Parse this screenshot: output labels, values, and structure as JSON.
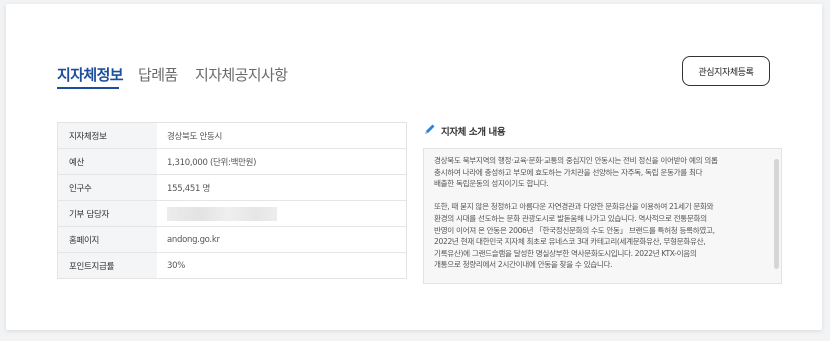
{
  "tabs": [
    {
      "label": "지자체정보",
      "active": true
    },
    {
      "label": "답례품",
      "active": false
    },
    {
      "label": "지자체공지사항",
      "active": false
    }
  ],
  "favorite_button": "관심지자체등록",
  "info_table": [
    {
      "label": "지자체정보",
      "value": "경상북도 안동시"
    },
    {
      "label": "예산",
      "value": "1,310,000 (단위:백만원)"
    },
    {
      "label": "인구수",
      "value": "155,451 명"
    },
    {
      "label": "기부 담당자",
      "value": ""
    },
    {
      "label": "홈페이지",
      "value": "andong.go.kr"
    },
    {
      "label": "포인트지급률",
      "value": "30%"
    }
  ],
  "intro": {
    "title": "지자체 소개 내용",
    "icon": "pencil-icon",
    "lines": [
      "경상북도 북부지역의 행정·교육·문화·교통의 중심지인 안동시는 전비 정신을 이어받아 예의 의롭",
      "충시하여 나라에 충성하고 부모에 효도하는 가치관을 선양하는 자주독, 독립 운동가를 최다",
      "배출한 독립운동의 성지이기도 합니다.",
      "",
      "또한, 때 묻지 않은 청정하고 아름다운 자연경관과 다양한 문화유산을 이용하여 21세기 문화와",
      "환경의 시대를 선도하는 문화 관광도시로 발돋움해 나가고 있습니다. 역사적으로 전통문화의",
      "반영이 이어져 온 안동은 2006년 「한국정신문화의 수도 안동」 브랜드를 특허청 등록하였고,",
      "2022년 현재 대한민국 지자체 최초로 유네스코 3대 카테고리(세계문화유산, 무형문화유산,",
      "기록유산)에 그랜드슬램을 달성한 명실상부한 역사문화도시입니다. 2022년 KTX-이음의",
      "개통으로 청량리에서 2시간이내에 안동을 찾을 수 있습니다."
    ]
  },
  "colors": {
    "accent": "#1d4e9c",
    "pencil": "#2b82d9"
  }
}
